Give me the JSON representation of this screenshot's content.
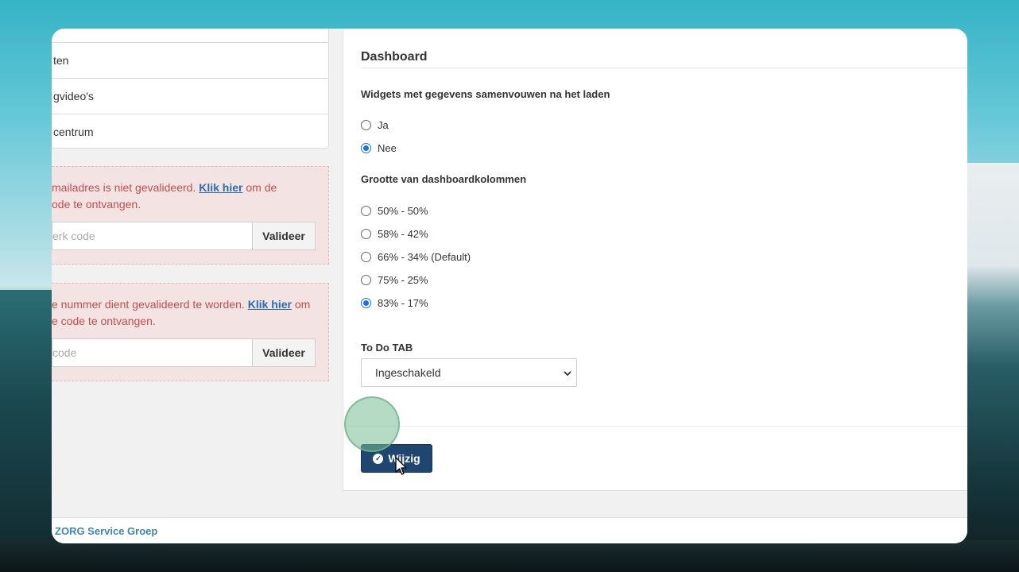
{
  "sidebar": {
    "items": [
      {
        "label": "ten"
      },
      {
        "label": "gvideo's"
      },
      {
        "label": "centrum"
      }
    ]
  },
  "alerts": [
    {
      "text_before": "mailadres is niet gevalideerd. ",
      "link": "Klik hier",
      "text_after": " om de",
      "line2": "ode te ontvangen.",
      "placeholder": "erk code",
      "button": "Valideer"
    },
    {
      "text_before": "e nummer dient gevalideerd te worden. ",
      "link": "Klik hier",
      "text_after": " om",
      "line2": "e code te ontvangen.",
      "placeholder": "code",
      "button": "Valideer"
    }
  ],
  "panel": {
    "title": "Dashboard",
    "widgets_label": "Widgets met gegevens samenvouwen na het laden",
    "widgets_options": [
      {
        "label": "Ja",
        "checked": false
      },
      {
        "label": "Nee",
        "checked": true
      }
    ],
    "columns_label": "Grootte van dashboardkolommen",
    "columns_options": [
      {
        "label": "50% - 50%",
        "checked": false
      },
      {
        "label": "58% - 42%",
        "checked": false
      },
      {
        "label": "66% - 34% (Default)",
        "checked": false
      },
      {
        "label": "75% - 25%",
        "checked": false
      },
      {
        "label": "83% - 17%",
        "checked": true
      }
    ],
    "todo_label": "To Do TAB",
    "todo_value": "Ingeschakeld",
    "submit_label": "Wijzig"
  },
  "footer": {
    "brand": "ZORG Service Groep"
  },
  "colors": {
    "primary_button": "#1f4670",
    "alert_text": "#c0504d",
    "link": "#2a6db0",
    "radio_checked": "#1a73e8"
  }
}
